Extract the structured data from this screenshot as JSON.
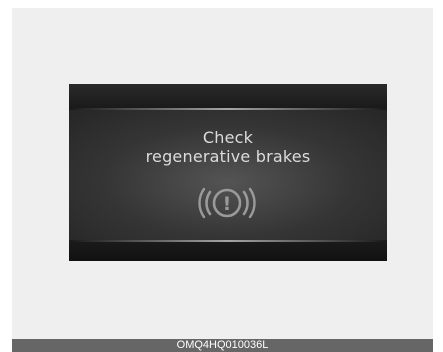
{
  "message": {
    "line1": "Check",
    "line2": "regenerative brakes"
  },
  "icon": {
    "name": "regenerative-brake-warning-icon",
    "glyph": "!"
  },
  "caption": "OMQ4HQ010036L"
}
